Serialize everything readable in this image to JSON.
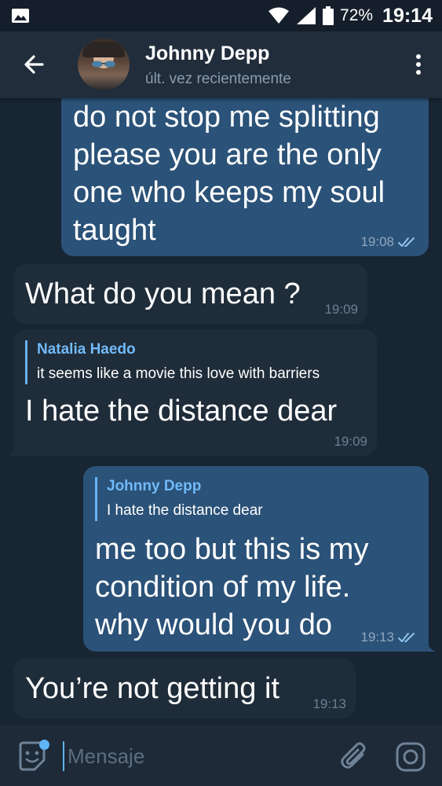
{
  "status_bar": {
    "battery": "72%",
    "time": "19:14",
    "icons": [
      "gallery-icon",
      "wifi-icon",
      "signal-icon",
      "battery-icon"
    ]
  },
  "header": {
    "contact_name": "Johnny Depp",
    "contact_status": "últ. vez recientemente",
    "icons": [
      "back-arrow-icon",
      "avatar",
      "more-vertical-icon"
    ]
  },
  "messages": [
    {
      "direction": "outgoing",
      "text": "do not stop me splitting\nplease you are the only\none who keeps my soul\ntaught",
      "time": "19:08",
      "read": true
    },
    {
      "direction": "incoming",
      "text": "What do you mean ?",
      "time": "19:09"
    },
    {
      "direction": "incoming",
      "reply_to": {
        "name": "Natalia Haedo",
        "text": "it seems like a movie this love with barriers"
      },
      "text": "I hate the distance dear",
      "time": "19:09"
    },
    {
      "direction": "outgoing",
      "reply_to": {
        "name": "Johnny Depp",
        "text": "I hate the distance dear"
      },
      "text": "me too but this is my\ncondition of my life.\nwhy would you do",
      "time": "19:13",
      "read": true
    },
    {
      "direction": "incoming",
      "text": "You’re not getting it",
      "time": "19:13"
    }
  ],
  "input_bar": {
    "placeholder": "Mensaje",
    "value": "",
    "icons": [
      "sticker-icon",
      "attach-icon",
      "camera-icon"
    ]
  },
  "colors": {
    "background": "#182533",
    "header": "#212d3b",
    "outgoing_bubble": "#2b5278",
    "incoming_bubble": "#1f2c39",
    "accent": "#5eb5f7"
  }
}
